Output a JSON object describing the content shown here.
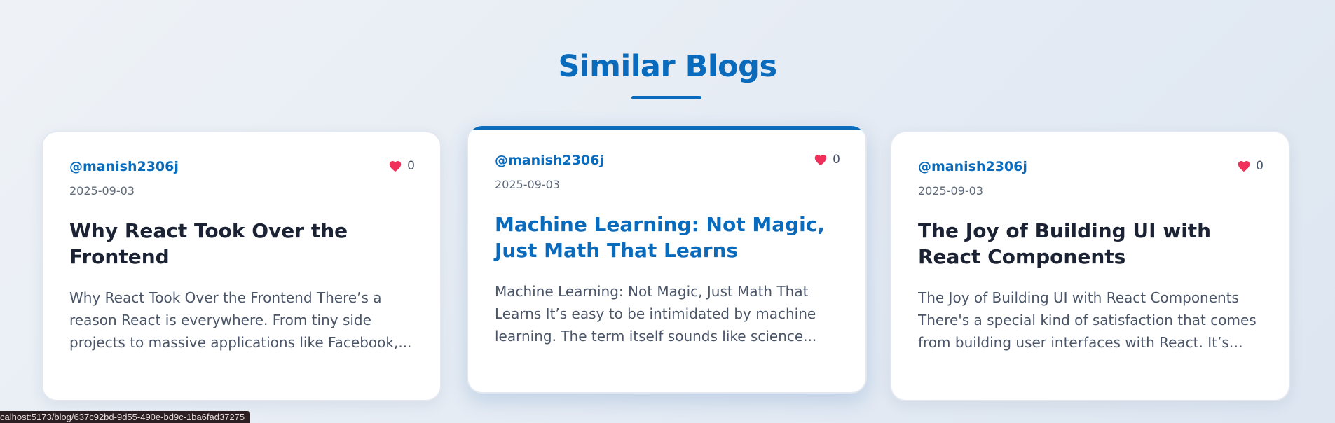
{
  "section": {
    "title": "Similar Blogs"
  },
  "cards": [
    {
      "author": "@manish2306j",
      "likes": "0",
      "date": "2025-09-03",
      "title": "Why React Took Over the Frontend",
      "excerpt": "Why React Took Over the Frontend There’s a reason React is everywhere. From tiny side projects to massive applications like Facebook,..."
    },
    {
      "author": "@manish2306j",
      "likes": "0",
      "date": "2025-09-03",
      "title": "Machine Learning: Not Magic, Just Math That Learns",
      "excerpt": "Machine Learning: Not Magic, Just Math That Learns It’s easy to be intimidated by machine learning. The term itself sounds like science..."
    },
    {
      "author": "@manish2306j",
      "likes": "0",
      "date": "2025-09-03",
      "title": "The Joy of Building UI with React Components",
      "excerpt": "The Joy of Building UI with React Components There's a special kind of satisfaction that comes from building user interfaces with React. It’s not..."
    }
  ],
  "status_bar": {
    "url": "calhost:5173/blog/637c92bd-9d55-490e-bd9c-1ba6fad37275"
  },
  "colors": {
    "accent": "#0a6bbd",
    "heart": "#f0305a"
  },
  "icons": {
    "like": "heart-icon"
  }
}
